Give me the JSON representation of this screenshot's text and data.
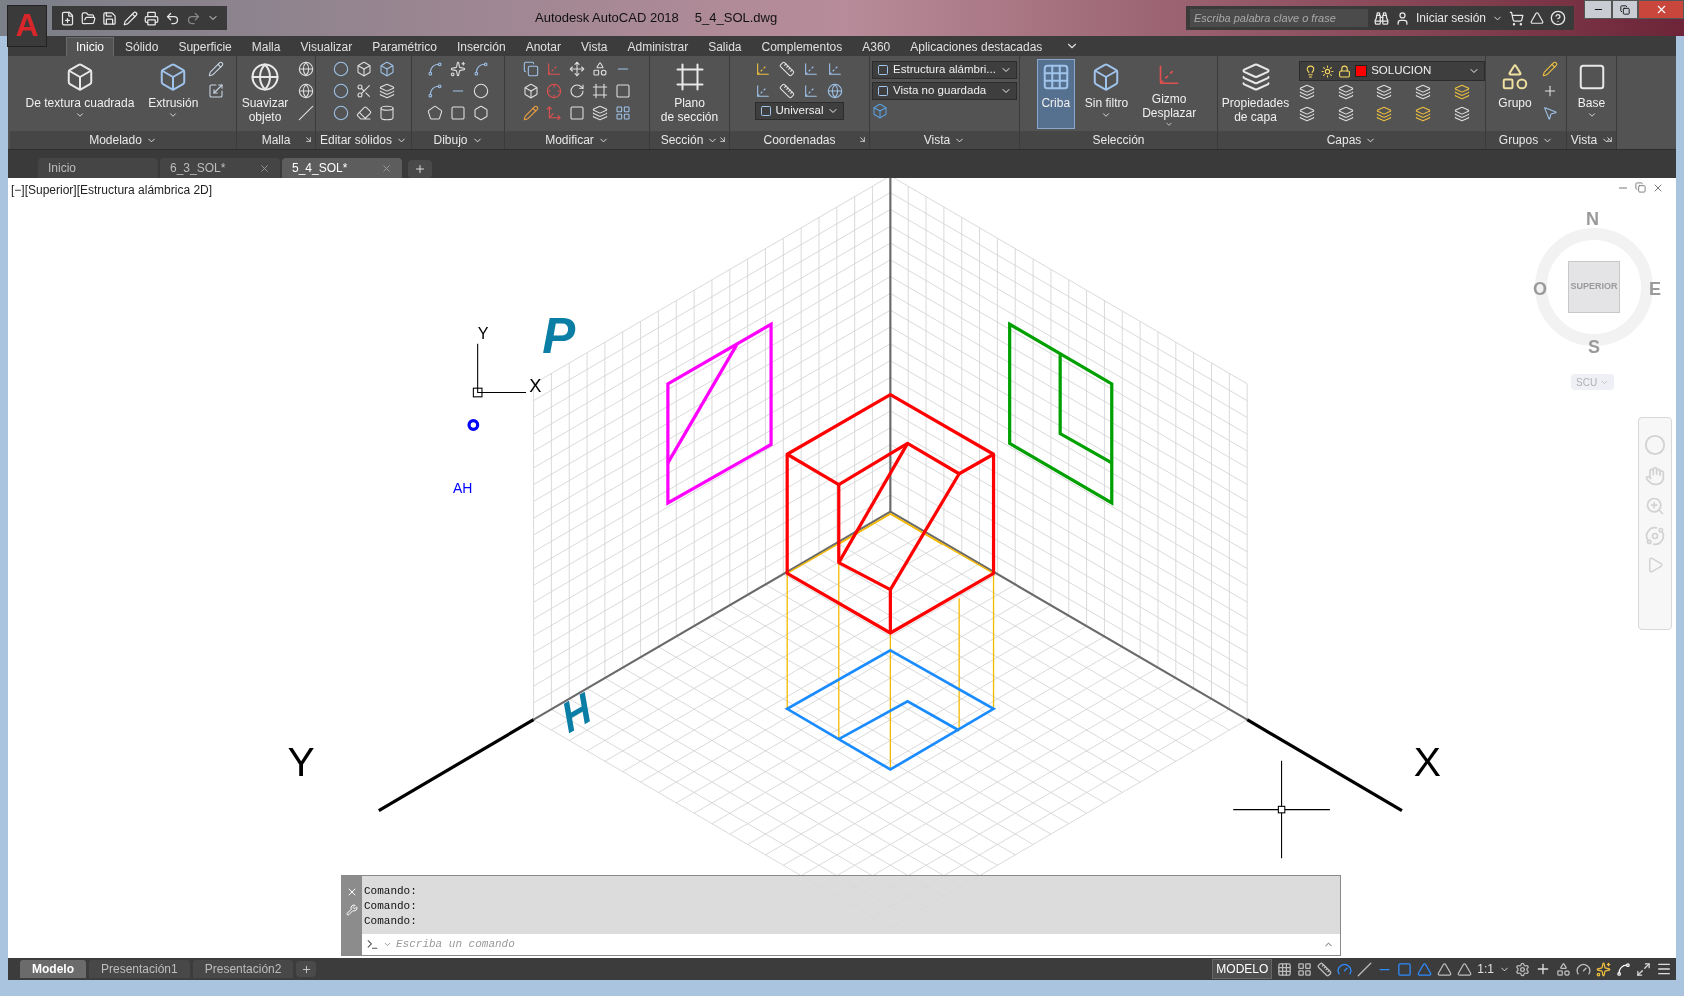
{
  "title_bar": {
    "app_button": "A",
    "app_title": "Autodesk AutoCAD 2018",
    "file_name": "5_4_SOL.dwg",
    "search": {
      "placeholder": "Escriba palabra clave o frase"
    },
    "sign_in": "Iniciar sesión"
  },
  "ribbon_tabs": [
    {
      "label": "Inicio",
      "selected": true
    },
    {
      "label": "Sólido",
      "selected": false
    },
    {
      "label": "Superficie",
      "selected": false
    },
    {
      "label": "Malla",
      "selected": false
    },
    {
      "label": "Visualizar",
      "selected": false
    },
    {
      "label": "Paramétrico",
      "selected": false
    },
    {
      "label": "Inserción",
      "selected": false
    },
    {
      "label": "Anotar",
      "selected": false
    },
    {
      "label": "Vista",
      "selected": false
    },
    {
      "label": "Administrar",
      "selected": false
    },
    {
      "label": "Salida",
      "selected": false
    },
    {
      "label": "Complementos",
      "selected": false
    },
    {
      "label": "A360",
      "selected": false
    },
    {
      "label": "Aplicaciones destacadas",
      "selected": false
    }
  ],
  "ribbon_panels": [
    {
      "title": "Modelado",
      "menu": true,
      "launcher": false,
      "buttons": [
        {
          "lines": [
            "De textura cuadrada"
          ],
          "dropdown": true,
          "active": false
        },
        {
          "lines": [
            "Extrusión"
          ],
          "dropdown": true,
          "active": false
        }
      ]
    },
    {
      "title": "Malla",
      "menu": false,
      "launcher": true,
      "buttons": [
        {
          "lines": [
            "Suavizar",
            "objeto"
          ],
          "dropdown": false,
          "active": false
        }
      ]
    },
    {
      "title": "Editar sólidos",
      "menu": true,
      "launcher": false
    },
    {
      "title": "Dibujo",
      "menu": true,
      "launcher": false
    },
    {
      "title": "Modificar",
      "menu": true,
      "launcher": false
    },
    {
      "title": "Sección",
      "menu": true,
      "launcher": true,
      "buttons": [
        {
          "lines": [
            "Plano",
            "de sección"
          ],
          "dropdown": false,
          "active": false
        }
      ]
    },
    {
      "title": "Coordenadas",
      "menu": false,
      "launcher": true,
      "dropdowns": [
        {
          "value": "Universal"
        }
      ]
    },
    {
      "title": "Vista",
      "menu": true,
      "launcher": false,
      "dropdowns": [
        {
          "value": "Estructura alámbri..."
        },
        {
          "value": "Vista no guardada"
        }
      ]
    },
    {
      "title": "Selección",
      "menu": false,
      "launcher": false,
      "buttons": [
        {
          "lines": [
            "Criba"
          ],
          "dropdown": false,
          "active": true
        },
        {
          "lines": [
            "Sin filtro"
          ],
          "dropdown": true,
          "active": false
        },
        {
          "lines": [
            "Gizmo",
            "Desplazar"
          ],
          "dropdown": true,
          "active": false
        }
      ]
    },
    {
      "title": "Capas",
      "menu": true,
      "launcher": false,
      "buttons": [
        {
          "lines": [
            "Propiedades",
            "de capa"
          ],
          "dropdown": false,
          "active": false
        }
      ],
      "layer": {
        "name": "SOLUCION",
        "color": "#ff0000"
      }
    },
    {
      "title": "Grupos",
      "menu": true,
      "launcher": false,
      "buttons": [
        {
          "lines": [
            "Grupo"
          ],
          "dropdown": false,
          "active": false
        }
      ]
    },
    {
      "title": "Vista",
      "menu": true,
      "launcher": true,
      "buttons": [
        {
          "lines": [
            "Base"
          ],
          "dropdown": true,
          "active": false
        }
      ]
    }
  ],
  "file_tabs": [
    {
      "label": "Inicio",
      "selected": false,
      "closable": false
    },
    {
      "label": "6_3_SOL*",
      "selected": false,
      "closable": true
    },
    {
      "label": "5_4_SOL*",
      "selected": true,
      "closable": true
    }
  ],
  "viewport": {
    "label": "[−][Superior][Estructura alámbrica 2D]"
  },
  "drawing": {
    "plane_labels": [
      "P",
      "H"
    ],
    "axis_labels": [
      "Y",
      "X"
    ],
    "ucs": {
      "y": "Y",
      "x": "X"
    },
    "annotation": "AH"
  },
  "viewcube": {
    "north": "N",
    "east": "E",
    "south": "S",
    "west": "O",
    "face": "SUPERIOR",
    "ucs": "SCU"
  },
  "command_line": {
    "history": [
      "Comando:",
      "Comando:",
      "Comando:"
    ],
    "placeholder": "Escriba un comando"
  },
  "layout_tabs": [
    {
      "label": "Modelo",
      "selected": true
    },
    {
      "label": "Presentación1",
      "selected": false
    },
    {
      "label": "Presentación2",
      "selected": false
    }
  ],
  "status_bar": {
    "space": "MODELO",
    "scale": "1:1",
    "toggles": [
      {
        "on": false
      },
      {
        "on": false
      },
      {
        "on": false
      },
      {
        "on": true
      },
      {
        "on": false
      },
      {
        "on": true
      },
      {
        "on": true
      },
      {
        "on": true
      },
      {
        "on": false
      },
      {
        "on": false
      }
    ]
  }
}
